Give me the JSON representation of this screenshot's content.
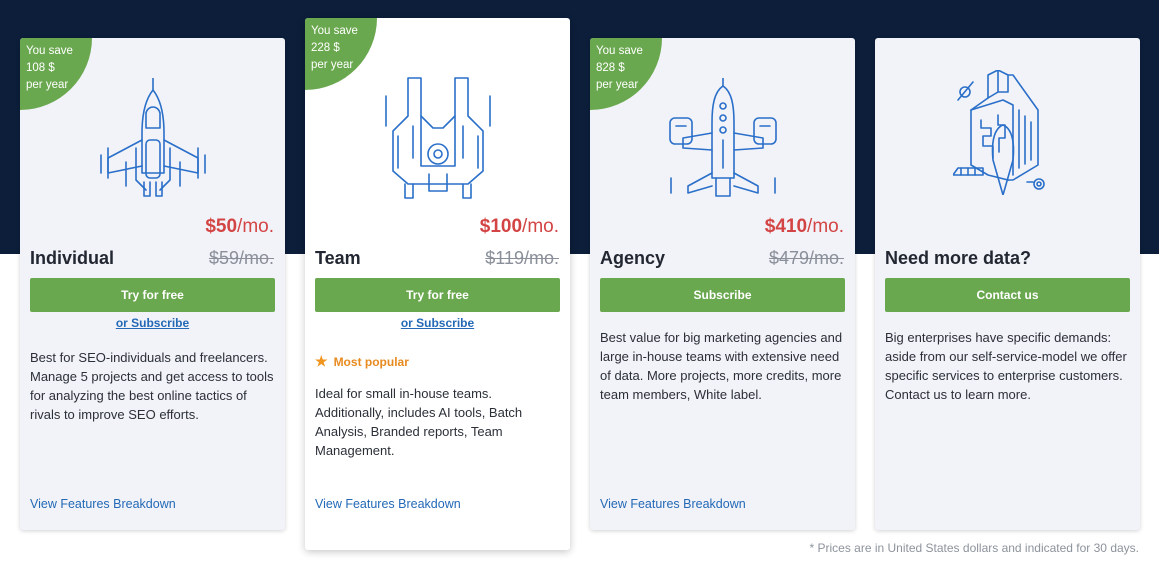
{
  "plans": [
    {
      "name": "Individual",
      "save": [
        "You save",
        "108 $",
        "per year"
      ],
      "price_now_amount": "$50",
      "price_now_unit": "/mo.",
      "price_old": "$59/mo.",
      "cta": "Try for free",
      "sub_link": "or Subscribe",
      "description": "Best for SEO-individuals and freelancers. Manage 5 projects and get access to tools for analyzing the best online tactics of rivals to improve SEO efforts.",
      "features_link": "View Features Breakdown"
    },
    {
      "name": "Team",
      "save": [
        "You save",
        "228 $",
        "per year"
      ],
      "price_now_amount": "$100",
      "price_now_unit": "/mo.",
      "price_old": "$119/mo.",
      "cta": "Try for free",
      "sub_link": "or Subscribe",
      "badge": "Most popular",
      "description": "Ideal for small in-house teams. Additionally, includes AI tools, Batch Analysis, Branded reports, Team Management.",
      "features_link": "View Features Breakdown"
    },
    {
      "name": "Agency",
      "save": [
        "You save",
        "828 $",
        "per year"
      ],
      "price_now_amount": "$410",
      "price_now_unit": "/mo.",
      "price_old": "$479/mo.",
      "cta": "Subscribe",
      "description": "Best value for big marketing agencies and large in-house teams with extensive need of data. More projects, more credits, more team members, White label.",
      "features_link": "View Features Breakdown"
    },
    {
      "name": "Need more data?",
      "cta": "Contact us",
      "description": "Big enterprises have specific demands: aside from our self-service-model we offer specific services to enterprise customers. Contact us to learn more."
    }
  ],
  "footnote": "* Prices are in United States dollars and indicated for 30 days.",
  "icons": {
    "plan_1": "spaceship-fighter-icon",
    "plan_2": "spaceship-cruiser-icon",
    "plan_3": "spaceship-carrier-icon",
    "plan_4": "spaceship-station-icon",
    "popular": "star-icon"
  },
  "colors": {
    "header_band": "#0c1e3a",
    "accent_green": "#6aa84f",
    "price_red": "#d34444",
    "link_blue": "#2369b6",
    "popular_orange": "#e88a1f"
  }
}
